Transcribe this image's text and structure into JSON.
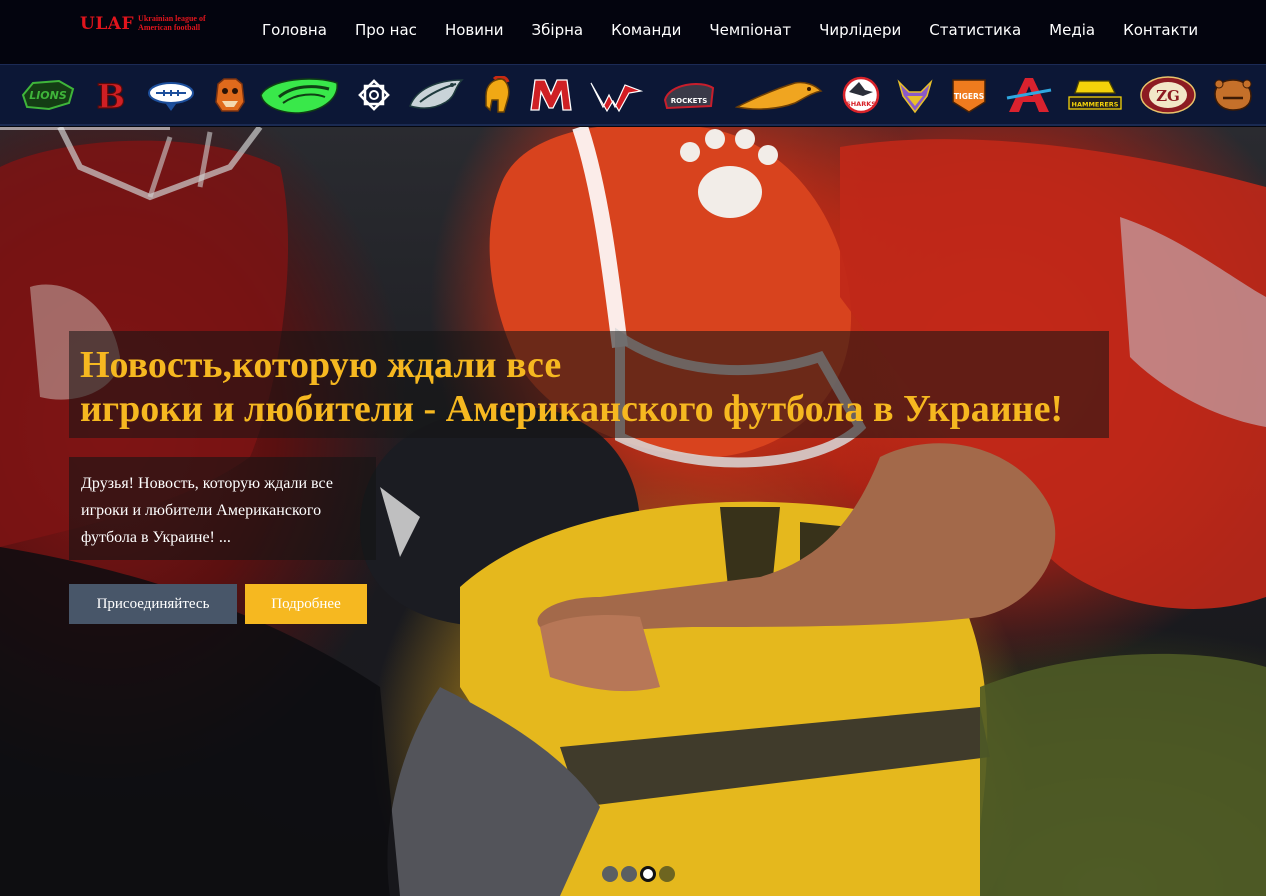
{
  "brand": {
    "mark": "ULAF",
    "subtitle": "Ukrainian league of American football"
  },
  "nav": {
    "items": [
      "Головна",
      "Про нас",
      "Новини",
      "Збірна",
      "Команди",
      "Чемпіонат",
      "Чирлідери",
      "Статистика",
      "Медіа",
      "Контакти"
    ]
  },
  "teams": [
    {
      "icon": "lions-logo-icon",
      "text": "LIONS",
      "color": "#3fb53a"
    },
    {
      "icon": "b-letter-logo-icon",
      "text": "B",
      "color": "#d01f24"
    },
    {
      "icon": "football-logo-icon",
      "text": "",
      "color": "#1d4f9c"
    },
    {
      "icon": "bulldog-logo-icon",
      "text": "",
      "color": "#e06a1c"
    },
    {
      "icon": "green-wing-logo-icon",
      "text": "",
      "color": "#39e84a"
    },
    {
      "icon": "star-emblem-logo-icon",
      "text": "",
      "color": "#ffffff"
    },
    {
      "icon": "eagle-logo-icon",
      "text": "",
      "color": "#c9d3d8"
    },
    {
      "icon": "spartan-helmet-logo-icon",
      "text": "",
      "color": "#f1a814"
    },
    {
      "icon": "m-letter-logo-icon",
      "text": "",
      "color": "#cf2024"
    },
    {
      "icon": "vw-wings-logo-icon",
      "text": "",
      "color": "#d21c22"
    },
    {
      "icon": "rockets-logo-icon",
      "text": "ROCKETS",
      "color": "#c81e2c"
    },
    {
      "icon": "cougar-logo-icon",
      "text": "",
      "color": "#f0a520"
    },
    {
      "icon": "sharks-logo-icon",
      "text": "SHARKS",
      "color": "#d8232a"
    },
    {
      "icon": "viking-logo-icon",
      "text": "",
      "color": "#8a5ac7"
    },
    {
      "icon": "tigers-logo-icon",
      "text": "TIGERS",
      "color": "#ef7b1e"
    },
    {
      "icon": "a-letter-logo-icon",
      "text": "",
      "color": "#d9222e"
    },
    {
      "icon": "hammerers-logo-icon",
      "text": "HAMMERERS",
      "color": "#f3d20a"
    },
    {
      "icon": "zg-logo-icon",
      "text": "ZG",
      "color": "#8c1b22"
    },
    {
      "icon": "bear-logo-icon",
      "text": "",
      "color": "#c5702a"
    }
  ],
  "hero": {
    "headline_line1": "Новость,которую ждали все",
    "headline_line2": "игроки и любители - Американского футбола в Украине!",
    "excerpt": "Друзья! Новость, которую ждали все игроки и любители Американского футбола в Украине! ...",
    "btn_join": "Присоединяйтесь",
    "btn_more": "Подробнее",
    "slides_total": 4,
    "active_slide": 3,
    "accent_color": "#f6b820"
  }
}
